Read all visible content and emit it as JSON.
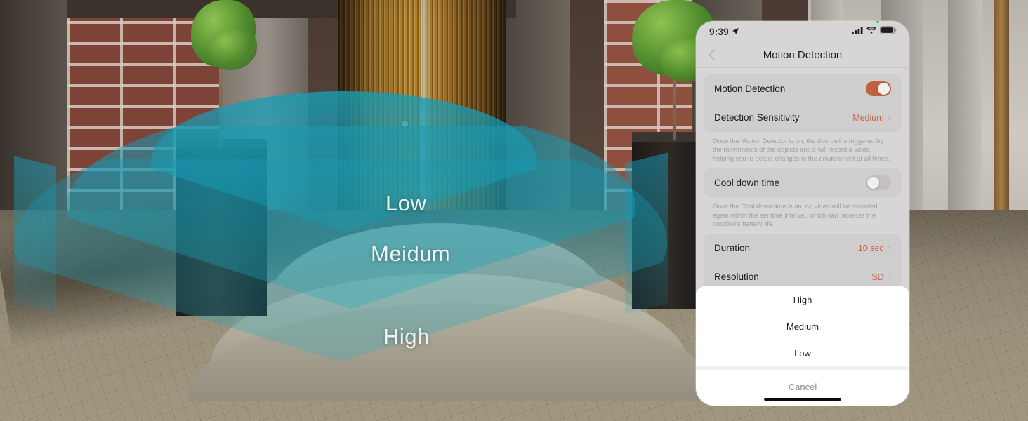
{
  "scene": {
    "zone_labels": [
      {
        "name": "low",
        "text": "Low"
      },
      {
        "name": "medium",
        "text": "Meidum"
      },
      {
        "name": "high",
        "text": "High"
      }
    ],
    "zone_color": "#189CB4"
  },
  "phone": {
    "status_bar": {
      "time": "9:39",
      "location_icon": "location-arrow-icon",
      "cellular_icon": "cellular-signal-icon",
      "wifi_icon": "wifi-icon",
      "battery_icon": "battery-full-icon"
    },
    "nav": {
      "back_icon": "chevron-left-icon",
      "title": "Motion Detection"
    },
    "accent_color": "#C1613F",
    "sections": [
      {
        "rows": [
          {
            "label": "Motion Detection",
            "control": "toggle",
            "state": "on"
          },
          {
            "label": "Detection Sensitivity",
            "control": "value",
            "value": "Medium"
          }
        ],
        "hint": "Once the Motion Detector is on, the doorbell is triggered by the movements of the objects and it will record a video, helping you to detect changes in the environment at all times."
      },
      {
        "rows": [
          {
            "label": "Cool down time",
            "control": "toggle",
            "state": "off"
          }
        ],
        "hint": "Once the  Cool down time is on, no video will be recorded again within the set time interval, which can increase the doorbell's battery life."
      },
      {
        "rows": [
          {
            "label": "Duration",
            "control": "value",
            "value": "10 sec"
          },
          {
            "label": "Resolution",
            "control": "value",
            "value": "SD"
          }
        ],
        "hint": ""
      }
    ],
    "action_sheet": {
      "options": [
        {
          "label": "High"
        },
        {
          "label": "Medium"
        },
        {
          "label": "Low"
        }
      ],
      "cancel_label": "Cancel"
    }
  }
}
